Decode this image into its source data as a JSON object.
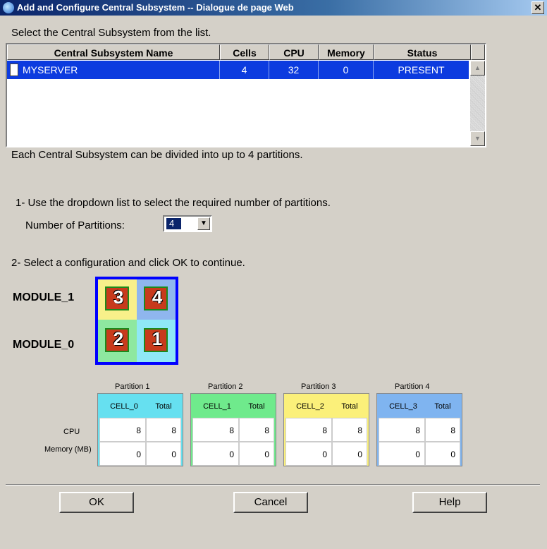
{
  "window": {
    "title": "Add and Configure Central Subsystem -- Dialogue de page Web",
    "close_glyph": "✕"
  },
  "intro": "Select the Central Subsystem from the list.",
  "table": {
    "headers": [
      "Central Subsystem Name",
      "Cells",
      "CPU",
      "Memory",
      "Status"
    ],
    "rows": [
      [
        "MYSERVER",
        "4",
        "32",
        "0",
        "PRESENT"
      ]
    ]
  },
  "divide_note": "Each Central Subsystem can be divided into up to 4 partitions.",
  "step1": "1- Use the dropdown list to select the required number of partitions.",
  "partitions_label": "Number of Partitions:",
  "partitions_value": "4",
  "step2": "2- Select a configuration and click OK to continue.",
  "modules": [
    "MODULE_1",
    "MODULE_0"
  ],
  "cell_numbers": [
    "3",
    "4",
    "2",
    "1"
  ],
  "row_labels": [
    "CPU",
    "Memory (MB)"
  ],
  "partitions": [
    {
      "title": "Partition 1",
      "cell": "CELL_0",
      "total_label": "Total",
      "cpu": "8",
      "cpu_total": "8",
      "mem": "0",
      "mem_total": "0",
      "color": "#66e0f0"
    },
    {
      "title": "Partition 2",
      "cell": "CELL_1",
      "total_label": "Total",
      "cpu": "8",
      "cpu_total": "8",
      "mem": "0",
      "mem_total": "0",
      "color": "#6fea8c"
    },
    {
      "title": "Partition 3",
      "cell": "CELL_2",
      "total_label": "Total",
      "cpu": "8",
      "cpu_total": "8",
      "mem": "0",
      "mem_total": "0",
      "color": "#fbf07a"
    },
    {
      "title": "Partition 4",
      "cell": "CELL_3",
      "total_label": "Total",
      "cpu": "8",
      "cpu_total": "8",
      "mem": "0",
      "mem_total": "0",
      "color": "#7fb4f0"
    }
  ],
  "buttons": {
    "ok": "OK",
    "cancel": "Cancel",
    "help": "Help"
  }
}
